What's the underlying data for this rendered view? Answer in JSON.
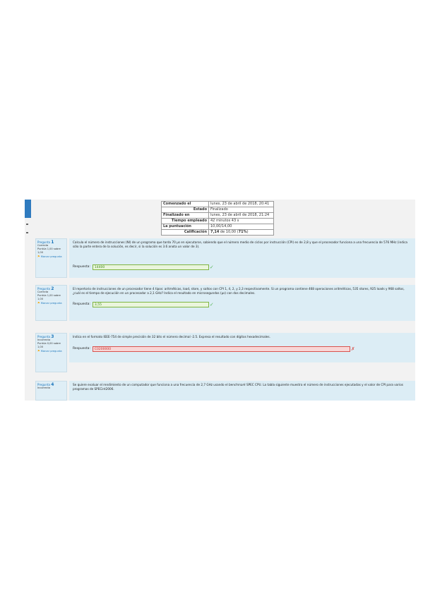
{
  "summary": {
    "rows": [
      {
        "label": "Comenzado el",
        "value": "lunes, 23 de abril de 2018, 20:41"
      },
      {
        "label": "Estado",
        "value": "Finalizado"
      },
      {
        "label": "Finalizado en",
        "value": "lunes, 23 de abril de 2018, 21:24"
      },
      {
        "label": "Tiempo empleado",
        "value": "42 minutos 43 s"
      },
      {
        "label": "La puntuación",
        "value": "10,00/14,00"
      },
      {
        "label": "Calificación",
        "value_pre": "7,14",
        "value_mid": " de 10,00 (",
        "value_pct": "71%",
        "value_post": ")"
      }
    ]
  },
  "questions": [
    {
      "title_word": "Pregunta",
      "number": "1",
      "status": "Correcta",
      "score": "Puntúa 1,00 sobre 1,00",
      "flag_label": "Marcar pregunta",
      "text": "Calcula el número de instrucciones (NI) de un programa que tarda 70 µs en ejecutarse, sabiendo que el número medio de ciclos por instrucción (CPI) es de 2,8 y que el procesador funciona a una frecuencia de 576 MHz (indica sólo la parte entera de la solución, es decir, si la solución es 3.6 anota un valor de 3).",
      "answer_label": "Respuesta:",
      "answer": "14400",
      "correct": true
    },
    {
      "title_word": "Pregunta",
      "number": "2",
      "status": "Correcta",
      "score": "Puntúa 1,00 sobre 1,00",
      "flag_label": "Marcar pregunta",
      "text": "El repertorio de instrucciones de un procesador tiene 4 tipos: aritméticas, load, store, y saltos con CPI 1, 4, 2, y 2,3 respectivamente. Si un programa contiene 468 operaciones aritméticas, 535 stores, 925 loads y 968 saltos, ¿cuál es el tiempo de ejecución en un procesador a 2,1 GHz? Indica el resultado en microsegundos (µs) con dos decimales.",
      "answer_label": "Respuesta:",
      "answer": "3,55",
      "correct": true
    },
    {
      "title_word": "Pregunta",
      "number": "3",
      "status": "Incorrecta",
      "score": "Puntúa 0,00 sobre 1,00",
      "flag_label": "Marcar pregunta",
      "text": "Indica en el formato IEEE-754 de simple precisión de 32 bits el número decimal -2.5. Expresa el resultado con dígitos hexadecimales.",
      "answer_label": "Respuesta:",
      "answer": "C0200000",
      "correct": false
    },
    {
      "title_word": "Pregunta",
      "number": "4",
      "status": "Incorrecta",
      "text_pre": "Se quiere evaluar el rendimiento de un computador que funciona a una frecuencia de 2,7 GHz usando el ",
      "text_em": "benchmark",
      "text_post": " SPEC CPU. La tabla siguiente muestra el número de instrucciones ejecutadas y el valor de CPI para varios programas de SPECint2006."
    }
  ],
  "colors": {
    "accent": "#1b75bb",
    "correct": "#5cb85c",
    "incorrect": "#d9534f",
    "panel": "#dcedf5"
  }
}
